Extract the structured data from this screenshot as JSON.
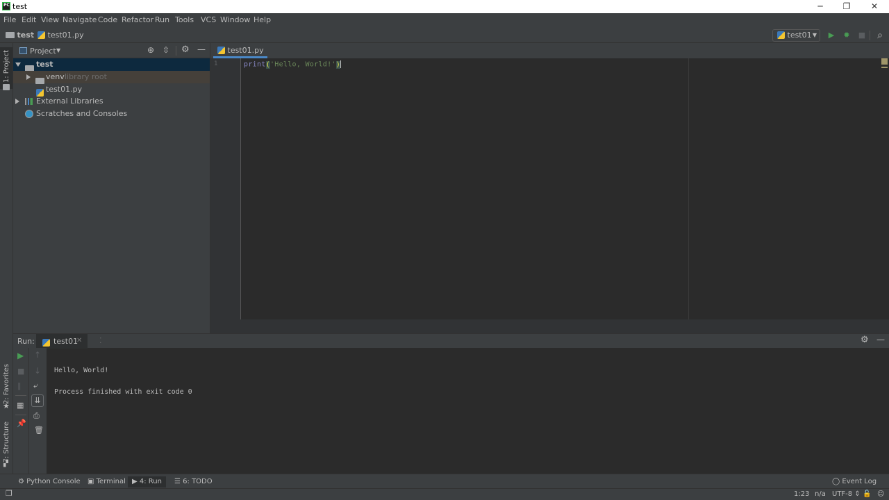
{
  "window": {
    "title": "test",
    "app_logo": "PC",
    "minimize": "─",
    "maximize": "❐",
    "close": "✕"
  },
  "menu": [
    "File",
    "Edit",
    "View",
    "Navigate",
    "Code",
    "Refactor",
    "Run",
    "Tools",
    "VCS",
    "Window",
    "Help"
  ],
  "breadcrumb": {
    "project": "test",
    "file": "test01.py"
  },
  "toolbar": {
    "run_config": "test01",
    "run_icon": "▶",
    "debug_icon": "✹",
    "stop_icon": "■",
    "search_icon": "⌕"
  },
  "left_strip": {
    "project_tab": "1: Project",
    "favorites_tab": "2: Favorites",
    "structure_tab": "7: Structure"
  },
  "project_panel": {
    "title": "Project",
    "tree": [
      {
        "label": "test",
        "hint": ""
      },
      {
        "label": "venv",
        "hint": "library root"
      },
      {
        "label": "test01.py",
        "hint": ""
      },
      {
        "label": "External Libraries",
        "hint": ""
      },
      {
        "label": "Scratches and Consoles",
        "hint": ""
      }
    ]
  },
  "editor": {
    "tab": "test01.py",
    "line_number": "1",
    "code": {
      "kw": "print",
      "open": "(",
      "str": "'Hello, World!'",
      "close": ")"
    }
  },
  "run_panel": {
    "label": "Run:",
    "tab": "test01",
    "output": [
      "Hello, World!",
      "Process finished with exit code 0"
    ]
  },
  "bottom_tabs": [
    {
      "label": "Python Console"
    },
    {
      "label": "Terminal"
    },
    {
      "label": "4: Run"
    },
    {
      "label": "6: TODO"
    }
  ],
  "event_log": "Event Log",
  "status": {
    "position": "1:23",
    "line_sep": "n/a",
    "encoding": "UTF-8 ⇕"
  }
}
